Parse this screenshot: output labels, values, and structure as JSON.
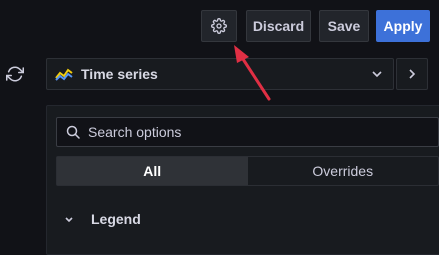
{
  "toolbar": {
    "settings_icon": "gear-icon",
    "discard_label": "Discard",
    "save_label": "Save",
    "apply_label": "Apply"
  },
  "refresh_icon": "refresh-icon",
  "visualization": {
    "icon": "time-series-icon",
    "label": "Time series",
    "dropdown_icon": "chevron-down-icon",
    "collapse_icon": "chevron-right-icon"
  },
  "options": {
    "search": {
      "icon": "search-icon",
      "placeholder": "Search options",
      "value": ""
    },
    "tabs": [
      {
        "label": "All",
        "active": true
      },
      {
        "label": "Overrides",
        "active": false
      }
    ],
    "sections": [
      {
        "label": "Legend",
        "icon": "chevron-down-icon",
        "expanded": true
      }
    ]
  },
  "annotation": {
    "icon": "red-arrow-annotation",
    "color": "#e02f44"
  },
  "colors": {
    "primary": "#3d71d9",
    "background": "#111217",
    "panel": "#181b1f"
  }
}
